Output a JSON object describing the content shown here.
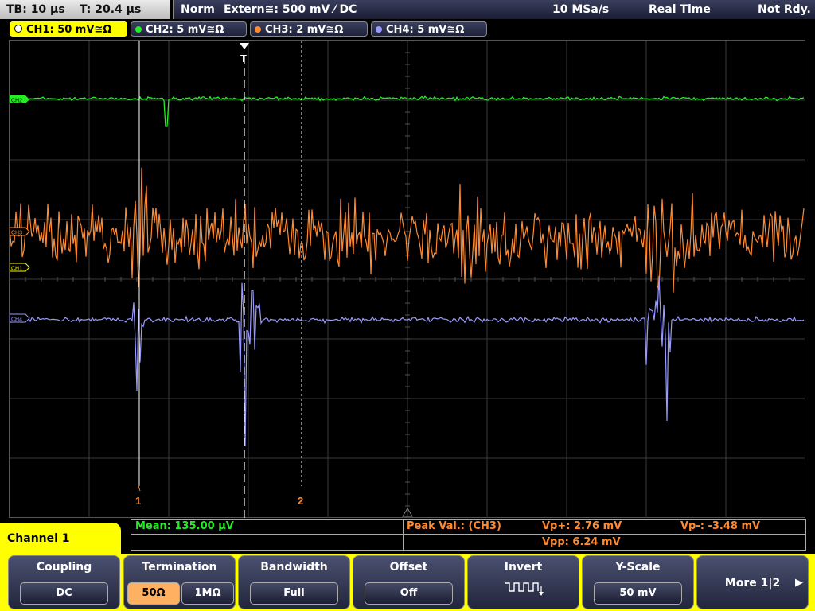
{
  "topbar": {
    "timebase": "TB: 10 µs",
    "trigger_time": "T: 20.4 µs",
    "trigger_mode": "Norm",
    "trigger_source": "Extern≅: 500 mV ⁄ DC",
    "sample_rate": "10 MSa/s",
    "acq_mode": "Real Time",
    "status": "Not Rdy."
  },
  "channels": [
    {
      "label": "CH1: 50 mV≅Ω",
      "color": "#ffff00"
    },
    {
      "label": "CH2: 5 mV≅Ω",
      "color": "#22ee22"
    },
    {
      "label": "CH3: 2 mV≅Ω",
      "color": "#ff8a30"
    },
    {
      "label": "CH4: 5 mV≅Ω",
      "color": "#9a9aff"
    }
  ],
  "markers": {
    "trigger": "T",
    "ch2_tag": "CH2",
    "ch3_tag": "CH3",
    "ch1_tag": "CH1",
    "ch4_tag": "CH4",
    "cursor1": "1",
    "cursor2": "2"
  },
  "measurements": {
    "mean": "Mean: 135.00 µV",
    "peak_label": "Peak Val.:  (CH3)",
    "vp_plus": "Vp+: 2.76 mV",
    "vp_minus": "Vp-: -3.48 mV",
    "vpp": "Vpp: 6.24 mV"
  },
  "menu": {
    "title": "Channel 1",
    "coupling": {
      "title": "Coupling",
      "value": "DC"
    },
    "termination": {
      "title": "Termination",
      "opt1": "50Ω",
      "opt2": "1MΩ"
    },
    "bandwidth": {
      "title": "Bandwidth",
      "value": "Full"
    },
    "offset": {
      "title": "Offset",
      "value": "Off"
    },
    "invert": {
      "title": "Invert"
    },
    "yscale": {
      "title": "Y-Scale",
      "value": "50 mV"
    },
    "more": {
      "label": "More 1|2"
    }
  }
}
